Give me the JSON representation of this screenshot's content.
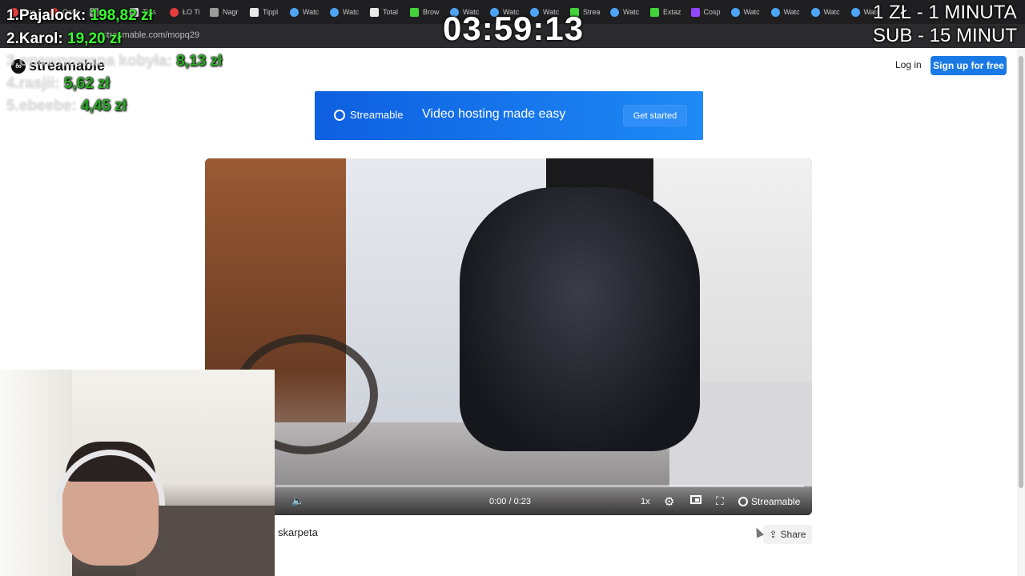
{
  "browser": {
    "tabs": [
      {
        "label": "Stre",
        "icon": "red"
      },
      {
        "label": "Orwe",
        "icon": "red"
      },
      {
        "label": "",
        "icon": "grey"
      },
      {
        "label": "Tips",
        "icon": "dark"
      },
      {
        "label": "ŁO Ti",
        "icon": "red"
      },
      {
        "label": "Nagr",
        "icon": "grey"
      },
      {
        "label": "Tippl",
        "icon": "dark"
      },
      {
        "label": "Watc",
        "icon": "blue"
      },
      {
        "label": "Watc",
        "icon": "blue"
      },
      {
        "label": "Total",
        "icon": "dark"
      },
      {
        "label": "Brow",
        "icon": "green"
      },
      {
        "label": "Watc",
        "icon": "blue"
      },
      {
        "label": "Watc",
        "icon": "blue"
      },
      {
        "label": "Watc",
        "icon": "blue"
      },
      {
        "label": "Strea",
        "icon": "green"
      },
      {
        "label": "Watc",
        "icon": "blue"
      },
      {
        "label": "Extaz",
        "icon": "green"
      },
      {
        "label": "Cosp",
        "icon": "purple"
      },
      {
        "label": "Watc",
        "icon": "blue"
      },
      {
        "label": "Watc",
        "icon": "blue"
      },
      {
        "label": "Watc",
        "icon": "blue"
      },
      {
        "label": "Watc",
        "icon": "blue"
      }
    ],
    "address": "streamable.com/mopq29"
  },
  "site": {
    "logo_text": "streamable",
    "login": "Log in",
    "signup": "Sign up for free"
  },
  "banner": {
    "brand": "Streamable",
    "tagline": "Video hosting made easy",
    "cta": "Get started"
  },
  "player": {
    "time": "0:00 / 0:23",
    "speed": "1x",
    "brand": "Streamable",
    "progress_fraction": 0
  },
  "video": {
    "title": "skarpeta",
    "share": "Share"
  },
  "stream_overlay": {
    "timer": "03:59:13",
    "leaderboard": [
      {
        "name": "1.Pajalock:",
        "amount": "198,82 zł"
      },
      {
        "name": "2.Karol:",
        "amount": "19,20 zł"
      },
      {
        "name": "3.opawnowana kobyła:",
        "amount": "8,13 zł"
      },
      {
        "name": "4.rasjii:",
        "amount": "5,62 zł"
      },
      {
        "name": "5.ebeebe:",
        "amount": "4,45 zł"
      }
    ],
    "rate_line_1": "1 ZŁ - 1 MINUTA",
    "rate_line_2": "SUB - 15 MINUT"
  }
}
